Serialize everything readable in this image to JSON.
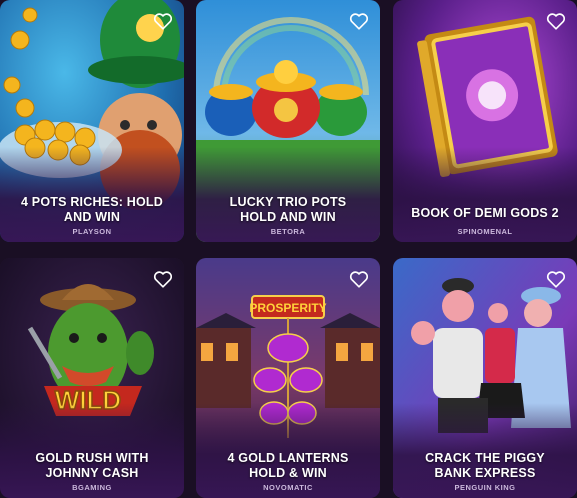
{
  "games": [
    {
      "title_line1": "4 POTS RICHES: HOLD",
      "title_line2": "AND WIN",
      "provider": "PLAYSON"
    },
    {
      "title_line1": "LUCKY TRIO POTS",
      "title_line2": "HOLD AND WIN",
      "provider": "BETORA"
    },
    {
      "title_line1": "BOOK OF DEMI GODS 2",
      "title_line2": "",
      "provider": "SPINOMENAL"
    },
    {
      "title_line1": "GOLD RUSH WITH",
      "title_line2": "JOHNNY CASH",
      "provider": "BGAMING"
    },
    {
      "title_line1": "4 GOLD LANTERNS",
      "title_line2": "HOLD & WIN",
      "provider": "NOVOMATIC"
    },
    {
      "title_line1": "CRACK THE PIGGY",
      "title_line2": "BANK EXPRESS",
      "provider": "PENGUIN KING"
    }
  ],
  "art_text": {
    "wild": "WILD",
    "prosperity": "PROSPERITY"
  },
  "colors": {
    "background": "#1a0f24",
    "card_footer": "#37165a",
    "title": "#ffffff",
    "provider": "#cbb8dc"
  },
  "icons": {
    "favorite": "heart-outline-icon"
  }
}
